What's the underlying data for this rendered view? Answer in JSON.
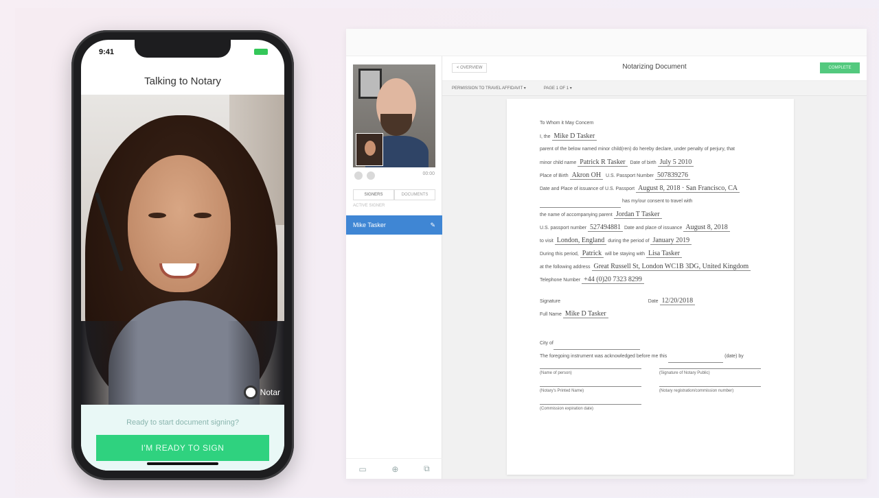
{
  "phone": {
    "time": "9:41",
    "title": "Talking to Notary",
    "brand": "Notar",
    "prompt": "Ready to start document signing?",
    "ready_button": "I'M READY TO SIGN"
  },
  "app": {
    "back_label": "< OVERVIEW",
    "title": "Notarizing Document",
    "action_label": "COMPLETE",
    "toolbar_doc": "PERMISSION TO TRAVEL AFFIDAVIT",
    "toolbar_page": "PAGE 1 OF 1",
    "call_timer": "00:00",
    "tabs": [
      "SIGNERS",
      "DOCUMENTS"
    ],
    "sub_label": "ACTIVE SIGNER",
    "signer_name": "Mike Tasker"
  },
  "document": {
    "l1": "To Whom it May Concern",
    "l2_label": "I, the",
    "l2_value": "Mike D Tasker",
    "l3": "parent of the below named minor child(ren) do hereby declare, under penalty of perjury, that",
    "l4_label": "minor child name",
    "l4_value": "Patrick R Tasker",
    "l4_label2": "Date of birth",
    "l4_value2": "July 5 2010",
    "l5_label": "Place of Birth",
    "l5_value": "Akron OH",
    "l5_label2": "U.S. Passport Number",
    "l5_value2": "507839276",
    "l6_label": "Date and Place of issuance of U.S. Passport",
    "l6_value": "August 8, 2018 · San Francisco, CA",
    "l7": "has my/our consent to travel with",
    "l8_label": "the name of accompanying parent",
    "l8_value": "Jordan T Tasker",
    "l9_label": "U.S. passport number",
    "l9_value": "527494881",
    "l9_label2": "Date and place of issuance",
    "l9_value2": "August 8, 2018",
    "l10_label": "to visit",
    "l10_value": "London, England",
    "l10_label2": "during the period of",
    "l10_value2": "January 2019",
    "l11_label": "During this period,",
    "l11_value": "Patrick",
    "l11_label2": "will be staying with",
    "l11_value2": "Lisa Tasker",
    "l12_label": "at the following address",
    "l12_value": "Great Russell St, London WC1B 3DG, United Kingdom",
    "l13_label": "Telephone Number",
    "l13_value": "+44 (0)20 7323 8299",
    "l14_label": "Signature",
    "l14_label2": "Date",
    "l14_value2": "12/20/2018",
    "l15_label": "Full Name",
    "l15_value": "Mike D Tasker",
    "l16_label": "City of",
    "l17": "The foregoing instrument was acknowledged before me this",
    "l17_end": "(date) by",
    "sig1a": "(Name of person)",
    "sig1b": "(Signature of Notary Public)",
    "sig2a": "(Notary's Printed Name)",
    "sig2b": "(Notary registration/commission number)",
    "sig3a": "(Commission expiration date)"
  }
}
